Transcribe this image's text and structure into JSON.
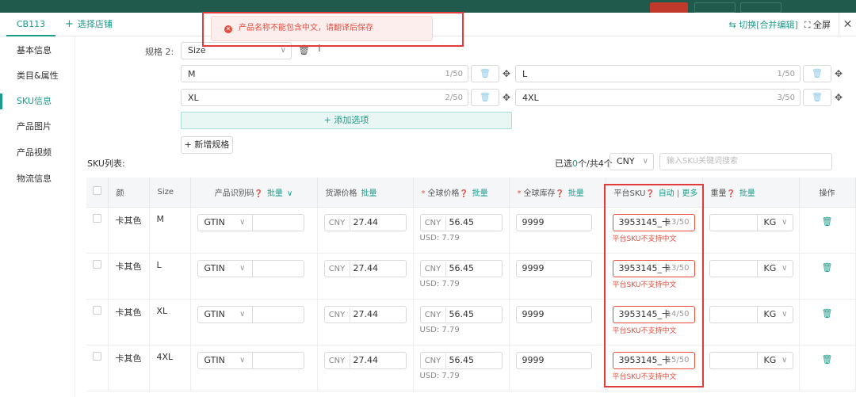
{
  "tabs": {
    "shop": "CB113",
    "add_shop": "选择店铺",
    "switch": "切换[合并编辑]",
    "fullscreen": "全屏"
  },
  "toast": {
    "message": "产品名称不能包含中文，请翻译后保存"
  },
  "sidebar": {
    "items": [
      {
        "label": "基本信息"
      },
      {
        "label": "类目&属性"
      },
      {
        "label": "SKU信息",
        "active": true
      },
      {
        "label": "产品图片"
      },
      {
        "label": "产品视频"
      },
      {
        "label": "物流信息"
      }
    ]
  },
  "spec": {
    "label": "规格 2:",
    "name": "Size",
    "options": [
      {
        "value": "M",
        "count": "1/50"
      },
      {
        "value": "L",
        "count": "1/50"
      },
      {
        "value": "XL",
        "count": "2/50"
      },
      {
        "value": "4XL",
        "count": "3/50"
      }
    ],
    "add_option": "+ 添加选项",
    "new_spec": "+ 新增规格"
  },
  "sku_list": {
    "title": "SKU列表:",
    "selected_prefix": "已选",
    "selected_count": "0",
    "selected_suffix": "个/共4个",
    "currency": "CNY",
    "search_placeholder": "输入SKU关键词搜索",
    "headers": {
      "color": "颜",
      "size": "Size",
      "gtin": "产品识别码",
      "gtin_bulk": "批量",
      "source_price": "货源价格",
      "source_bulk": "批量",
      "global_price": "全球价格",
      "global_price_bulk": "批量",
      "global_stock": "全球库存",
      "global_stock_bulk": "批量",
      "platform_sku": "平台SKU",
      "auto": "自动",
      "more": "更多",
      "weight": "重量",
      "weight_bulk": "批量",
      "action": "操作"
    },
    "rows": [
      {
        "color": "卡其色",
        "size": "M",
        "gtin_type": "GTIN",
        "source_cur": "CNY",
        "source_price": "27.44",
        "global_cur": "CNY",
        "global_price": "56.45",
        "usd": "USD: 7.79",
        "stock": "9999",
        "platform_sku": "3953145_卡",
        "sku_count": "13/50",
        "sku_error": "平台SKU不支持中文",
        "weight_unit": "KG"
      },
      {
        "color": "卡其色",
        "size": "L",
        "gtin_type": "GTIN",
        "source_cur": "CNY",
        "source_price": "27.44",
        "global_cur": "CNY",
        "global_price": "56.45",
        "usd": "USD: 7.79",
        "stock": "9999",
        "platform_sku": "3953145_卡",
        "sku_count": "13/50",
        "sku_error": "平台SKU不支持中文",
        "weight_unit": "KG"
      },
      {
        "color": "卡其色",
        "size": "XL",
        "gtin_type": "GTIN",
        "source_cur": "CNY",
        "source_price": "27.44",
        "global_cur": "CNY",
        "global_price": "56.45",
        "usd": "USD: 7.79",
        "stock": "9999",
        "platform_sku": "3953145_卡",
        "sku_count": "14/50",
        "sku_error": "平台SKU不支持中文",
        "weight_unit": "KG"
      },
      {
        "color": "卡其色",
        "size": "4XL",
        "gtin_type": "GTIN",
        "source_cur": "CNY",
        "source_price": "27.44",
        "global_cur": "CNY",
        "global_price": "56.45",
        "usd": "USD: 7.79",
        "stock": "9999",
        "platform_sku": "3953145_卡",
        "sku_count": "15/50",
        "sku_error": "平台SKU不支持中文",
        "weight_unit": "KG"
      }
    ]
  },
  "colors": {
    "accent": "#1a9c8a",
    "error": "#e74c3c",
    "annotation": "#e23b3b"
  }
}
